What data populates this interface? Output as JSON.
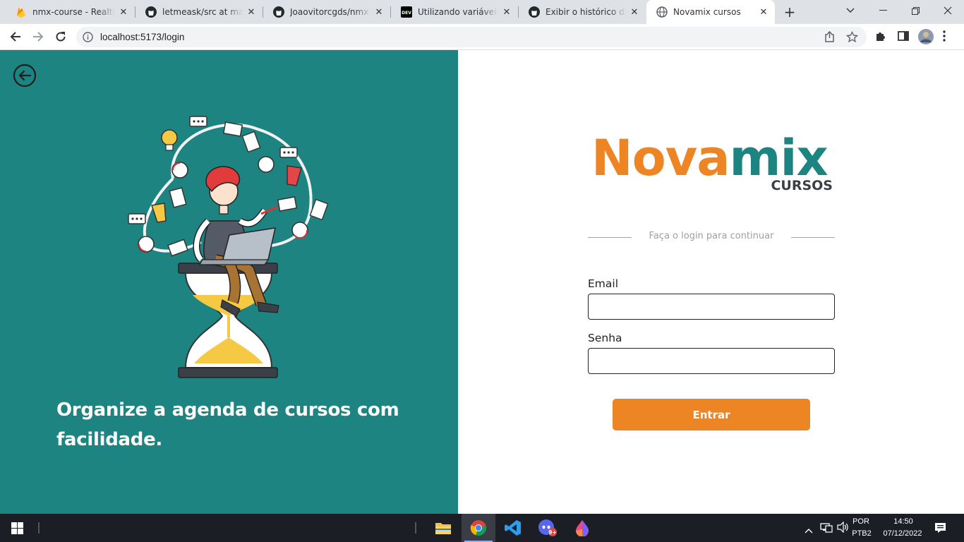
{
  "browser": {
    "tabs": [
      {
        "title": "nmx-course - Realtime",
        "icon": "firebase-icon"
      },
      {
        "title": "letmeask/src at main ·",
        "icon": "github-icon"
      },
      {
        "title": "Joaovitorcgds/nmx-co",
        "icon": "github-icon"
      },
      {
        "title": "Utilizando variáveis de",
        "icon": "dev-icon"
      },
      {
        "title": "Exibir o histórico de in",
        "icon": "github-icon"
      },
      {
        "title": "Novamix cursos",
        "icon": "globe-icon",
        "active": true
      }
    ],
    "url": "localhost:5173/login"
  },
  "left": {
    "tagline": "Organize a agenda de cursos com facilidade."
  },
  "brand": {
    "part1": "Nova",
    "part2": "mix",
    "sub": "CURSOS",
    "colors": {
      "orange": "#ee8524",
      "teal": "#1e8481"
    }
  },
  "login": {
    "divider_text": "Faça o login para continuar",
    "email_label": "Email",
    "email_value": "",
    "password_label": "Senha",
    "password_value": "",
    "submit_label": "Entrar"
  },
  "taskbar": {
    "lang_top": "POR",
    "lang_bottom": "PTB2",
    "time": "14:50",
    "date": "07/12/2022",
    "badge": "9+"
  }
}
